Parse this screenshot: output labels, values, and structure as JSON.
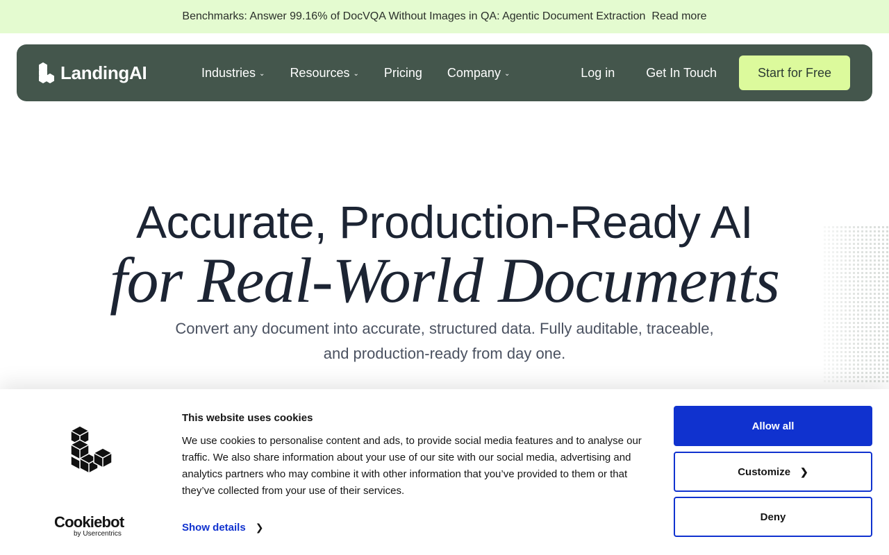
{
  "announcement": {
    "message": "Benchmarks: Answer 99.16% of DocVQA Without Images in QA: Agentic Document Extraction",
    "link": "Read more"
  },
  "nav": {
    "brand": "LandingAI",
    "links": [
      "Industries",
      "Resources",
      "Pricing",
      "Company"
    ],
    "login": "Log in",
    "contact": "Get In Touch",
    "cta": "Start for Free"
  },
  "hero": {
    "title_line1": "Accurate, Production-Ready AI",
    "title_line2": "for Real-World Documents",
    "subtitle_line1": "Convert any document into accurate, structured data. Fully auditable, traceable,",
    "subtitle_line2": "and production-ready from day one."
  },
  "cookie_banner": {
    "heading": "This website uses cookies",
    "body": "We use cookies to personalise content and ads, to provide social media features and to analyse our traffic. We also share information about your use of our site with our social media, advertising and analytics partners who may combine it with other information that you’ve provided to them or that they’ve collected from your use of their services.",
    "show_details": "Show details",
    "provider_name": "Cookiebot",
    "provider_by": "by Usercentrics",
    "allow_all": "Allow all",
    "customize": "Customize",
    "deny": "Deny"
  },
  "colors": {
    "announcement_bg": "#e4fbd0",
    "nav_bg": "#44564c",
    "cta_bg": "#dcfa9c",
    "cookie_primary": "#1032cf"
  },
  "icons": [
    "landingai-logo-icon",
    "chevron-down-icon",
    "chevron-right-icon",
    "cookie-brand-logo-icon"
  ]
}
